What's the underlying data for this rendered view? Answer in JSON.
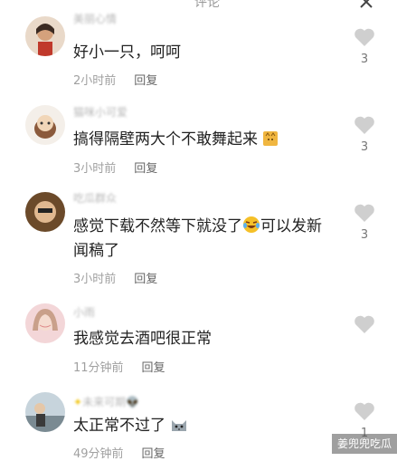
{
  "header": {
    "title": "评论"
  },
  "comments": [
    {
      "name": "美丽心情",
      "text": "好小一只，呵呵",
      "time": "2小时前",
      "reply": "回复",
      "likes": "3"
    },
    {
      "name": "猫咪小可爱",
      "text": "搞得隔壁两大个不敢舞起来",
      "time": "3小时前",
      "reply": "回复",
      "likes": "3"
    },
    {
      "name": "吃瓜群众",
      "text_line1": "感觉下载不然等下就没了",
      "text_line1b": "可以发新",
      "text_line2": "闻稿了",
      "time": "3小时前",
      "reply": "回复",
      "likes": "3"
    },
    {
      "name": "小雨",
      "text": "我感觉去酒吧很正常",
      "time": "11分钟前",
      "reply": "回复",
      "likes": ""
    },
    {
      "name": "未来可期",
      "text": "太正常不过了",
      "time": "49分钟前",
      "reply": "回复",
      "likes": "1"
    }
  ],
  "watermark": "姜兜兜吃瓜",
  "colors": {
    "heart": "#cfcfcf",
    "meta": "#a0a0a0"
  }
}
